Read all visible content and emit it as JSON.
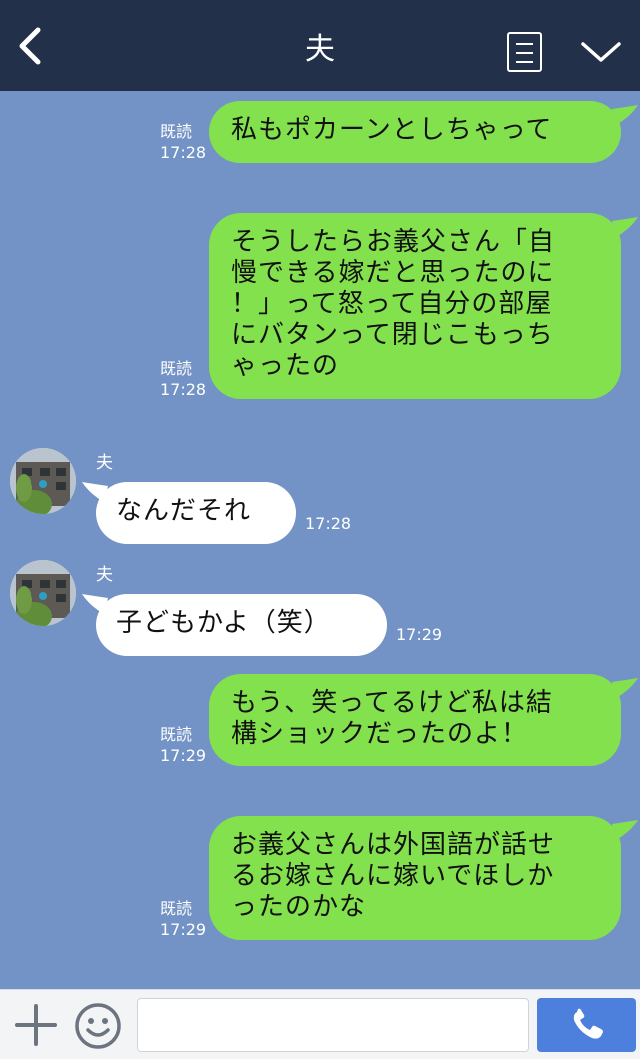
{
  "header": {
    "title": "夫",
    "icons": {
      "back": "chevron-left-icon",
      "menu": "list-menu-icon",
      "collapse": "chevron-down-icon"
    }
  },
  "messages": [
    {
      "dir": "out",
      "lines": [
        "私もポカーンとしちゃって"
      ],
      "read": "既読",
      "time": "17:28"
    },
    {
      "dir": "out",
      "lines": [
        "そうしたらお義父さん「自",
        "慢できる嫁だと思ったのに",
        "！」って怒って自分の部屋",
        "にバタンって閉じこもっち",
        "ゃったの"
      ],
      "read": "既読",
      "time": "17:28"
    },
    {
      "dir": "in",
      "sender": "夫",
      "lines": [
        "なんだそれ"
      ],
      "time": "17:28"
    },
    {
      "dir": "in",
      "sender": "夫",
      "lines": [
        "子どもかよ（笑）"
      ],
      "time": "17:29"
    },
    {
      "dir": "out",
      "lines": [
        "もう、笑ってるけど私は結",
        "構ショックだったのよ！"
      ],
      "read": "既読",
      "time": "17:29"
    },
    {
      "dir": "out",
      "lines": [
        "お義父さんは外国語が話せ",
        "るお嫁さんに嫁いでほしか",
        "ったのかな"
      ],
      "read": "既読",
      "time": "17:29"
    }
  ],
  "input": {
    "value": "",
    "placeholder": ""
  },
  "colors": {
    "header_bg": "#233049",
    "chat_bg": "#7393c6",
    "outgoing_bubble": "#84e14e",
    "incoming_bubble": "#ffffff",
    "send_button": "#4d7fdd"
  },
  "bottom_icons": {
    "add": "plus-icon",
    "sticker": "smiley-icon",
    "call": "phone-icon"
  }
}
